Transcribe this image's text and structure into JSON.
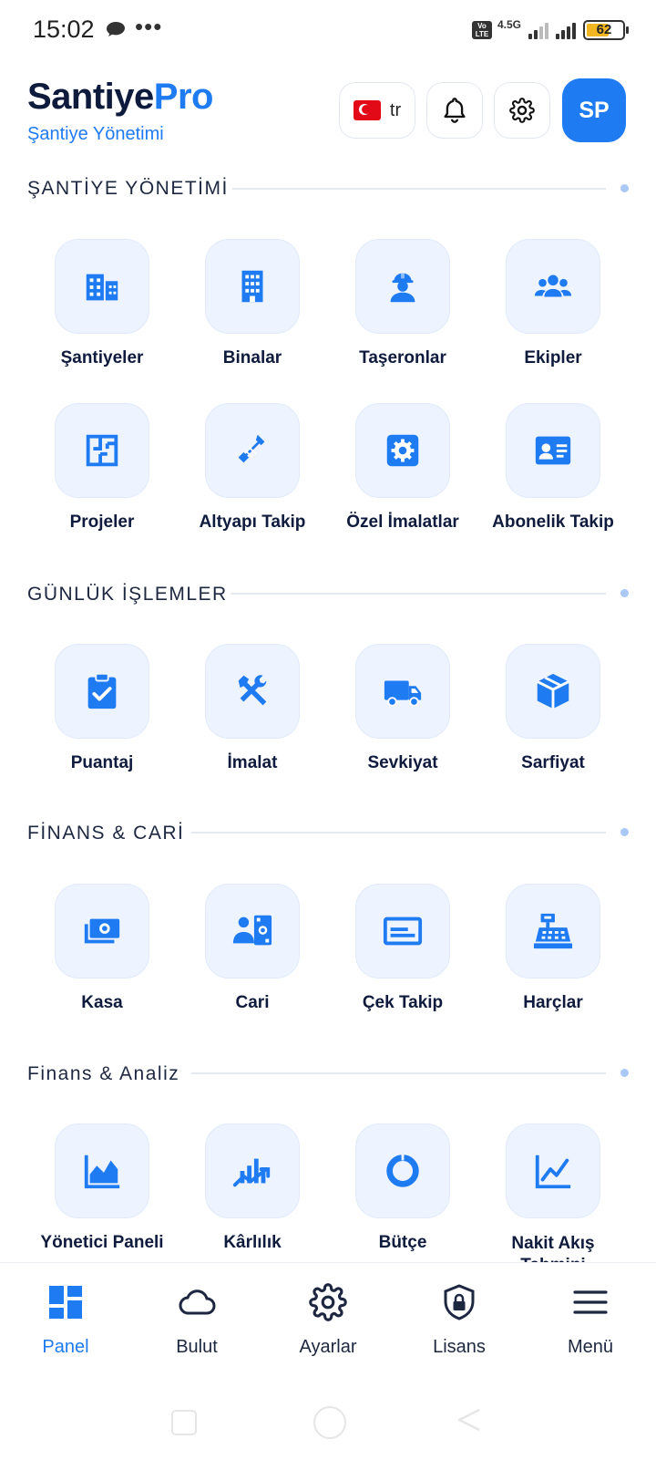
{
  "status_bar": {
    "time": "15:02",
    "dots": "•••",
    "volte": "Vo LTE",
    "network": "4.5G",
    "battery": "62",
    "battery_level": 0.62
  },
  "header": {
    "brand_part1": "Santiye",
    "brand_part2": "Pro",
    "subtitle": "Şantiye Yönetimi",
    "lang_code": "tr",
    "avatar_initials": "SP"
  },
  "sections": [
    {
      "title": "ŞANTİYE YÖNETİMİ",
      "items": [
        {
          "label": "Şantiyeler",
          "icon": "buildings-icon"
        },
        {
          "label": "Binalar",
          "icon": "building-icon"
        },
        {
          "label": "Taşeronlar",
          "icon": "worker-icon"
        },
        {
          "label": "Ekipler",
          "icon": "team-icon"
        },
        {
          "label": "Projeler",
          "icon": "floorplan-icon"
        },
        {
          "label": "Altyapı Takip",
          "icon": "wrench-pipe-icon"
        },
        {
          "label": "Özel İmalatlar",
          "icon": "cog-square-icon"
        },
        {
          "label": "Abonelik Takip",
          "icon": "id-card-icon"
        }
      ]
    },
    {
      "title": "GÜNLÜK İŞLEMLER",
      "items": [
        {
          "label": "Puantaj",
          "icon": "clipboard-check-icon"
        },
        {
          "label": "İmalat",
          "icon": "tools-icon"
        },
        {
          "label": "Sevkiyat",
          "icon": "truck-icon"
        },
        {
          "label": "Sarfiyat",
          "icon": "box-icon"
        }
      ]
    },
    {
      "title": "FİNANS & CARİ",
      "items": [
        {
          "label": "Kasa",
          "icon": "cash-icon"
        },
        {
          "label": "Cari",
          "icon": "account-card-icon"
        },
        {
          "label": "Çek Takip",
          "icon": "check-icon"
        },
        {
          "label": "Harçlar",
          "icon": "cash-register-icon"
        }
      ]
    },
    {
      "title": "Finans & Analiz",
      "items": [
        {
          "label": "Yönetici Paneli",
          "icon": "area-chart-icon"
        },
        {
          "label": "Kârlılık",
          "icon": "profit-chart-icon"
        },
        {
          "label": "Bütçe",
          "icon": "donut-chart-icon"
        },
        {
          "label": "Nakit Akış Tahmini",
          "icon": "line-chart-icon"
        }
      ]
    }
  ],
  "bottom_nav": [
    {
      "label": "Panel",
      "icon": "dashboard-icon",
      "active": true
    },
    {
      "label": "Bulut",
      "icon": "cloud-icon",
      "active": false
    },
    {
      "label": "Ayarlar",
      "icon": "settings-icon",
      "active": false
    },
    {
      "label": "Lisans",
      "icon": "shield-lock-icon",
      "active": false
    },
    {
      "label": "Menü",
      "icon": "menu-icon",
      "active": false
    }
  ],
  "colors": {
    "accent": "#1f7bf2",
    "dark_text": "#0f1b3d",
    "tile_bg": "#eef4ff"
  }
}
